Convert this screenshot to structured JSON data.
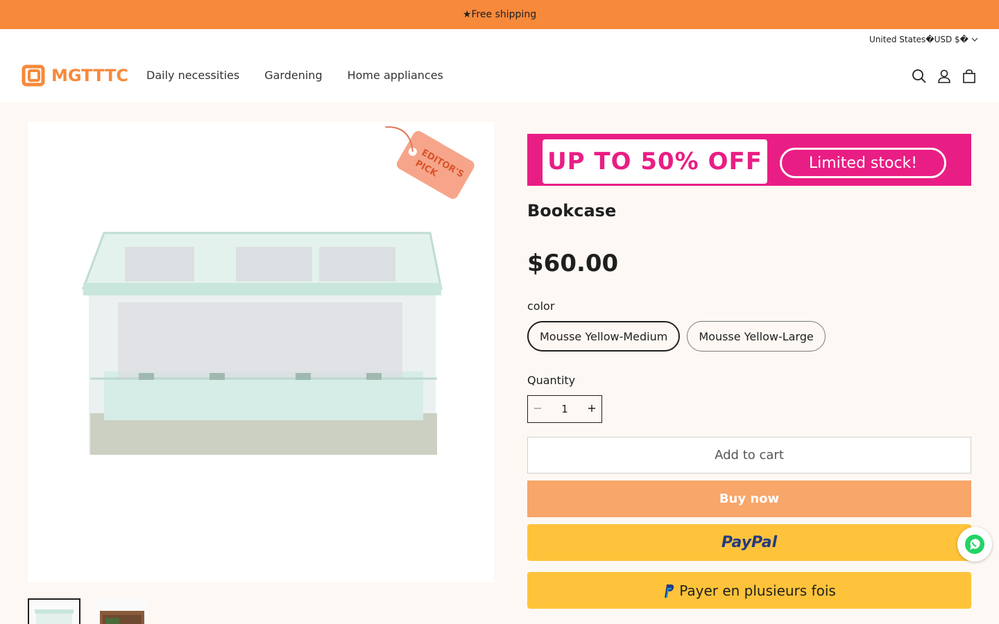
{
  "announcement": "★Free shipping",
  "header": {
    "locale": "United States�USD $�",
    "logo_text": "MGTTTC",
    "nav": [
      "Daily necessities",
      "Gardening",
      "Home appliances"
    ]
  },
  "gallery": {
    "badge_text": "EDITOR'S PICK"
  },
  "promo": {
    "left_text": "UP TO 50% OFF",
    "right_text": "Limited stock!"
  },
  "product": {
    "title": "Bookcase",
    "price": "$60.00",
    "option_label": "color",
    "variants": [
      "Mousse Yellow-Medium",
      "Mousse Yellow-Large"
    ],
    "selected_variant": "Mousse Yellow-Medium",
    "quantity_label": "Quantity",
    "quantity": "1",
    "add_to_cart": "Add to cart",
    "buy_now": "Buy now",
    "paypal_label": "PayPal",
    "paypal_later": "Payer en plusieurs fois"
  },
  "colors": {
    "accent": "#f7893b",
    "buy_now": "#f8a66a",
    "paypal": "#fec33a",
    "promo": "#e91e84"
  }
}
